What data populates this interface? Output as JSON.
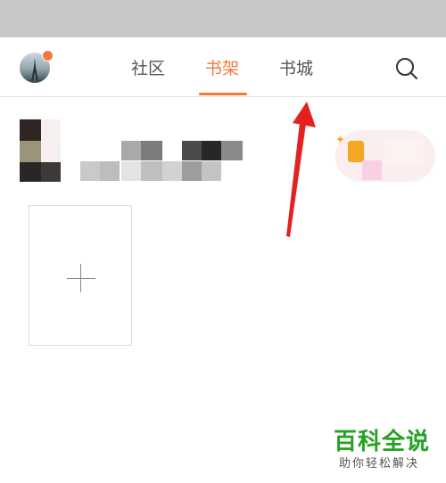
{
  "nav": {
    "tabs": [
      {
        "label": "社区",
        "active": false
      },
      {
        "label": "书架",
        "active": true
      },
      {
        "label": "书城",
        "active": false
      }
    ],
    "search_icon": "search-icon",
    "avatar_badge_color": "#f07a3e"
  },
  "colors": {
    "accent": "#f07a3e",
    "status_bar": "#c8c8c8",
    "annotation_arrow": "#e52020",
    "watermark_green": "#22a322"
  },
  "shelf": {
    "add_card_icon": "plus-icon"
  },
  "watermark": {
    "title": "百科全说",
    "subtitle": "助你轻松解决"
  }
}
